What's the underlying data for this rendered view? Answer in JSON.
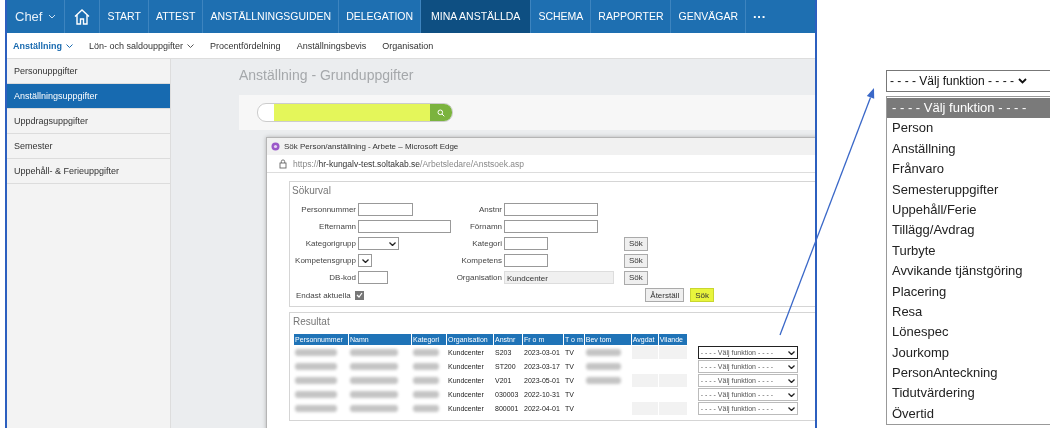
{
  "top_nav": {
    "role": {
      "label": "Chef"
    },
    "items": [
      {
        "label": "START",
        "selected": false
      },
      {
        "label": "ATTEST",
        "selected": false
      },
      {
        "label": "ANSTÄLLNINGSGUIDEN",
        "selected": false
      },
      {
        "label": "DELEGATION",
        "selected": false
      },
      {
        "label": "MINA ANSTÄLLDA",
        "selected": true
      },
      {
        "label": "SCHEMA",
        "selected": false
      },
      {
        "label": "RAPPORTER",
        "selected": false
      },
      {
        "label": "GENVÄGAR",
        "selected": false
      }
    ],
    "more": "···"
  },
  "sub_nav": [
    {
      "label": "Anställning",
      "selected": true,
      "has_menu": true
    },
    {
      "label": "Lön- och saldouppgifter",
      "selected": false,
      "has_menu": true
    },
    {
      "label": "Procentfördelning",
      "selected": false,
      "has_menu": false
    },
    {
      "label": "Anställningsbevis",
      "selected": false,
      "has_menu": false
    },
    {
      "label": "Organisation",
      "selected": false,
      "has_menu": false
    }
  ],
  "sidebar": {
    "items": [
      {
        "label": "Personuppgifter",
        "selected": false
      },
      {
        "label": "Anställningsuppgifter",
        "selected": true
      },
      {
        "label": "Uppdragsuppgifter",
        "selected": false
      },
      {
        "label": "Semester",
        "selected": false
      },
      {
        "label": "Uppehåll- & Ferieuppgifter",
        "selected": false
      }
    ]
  },
  "main": {
    "title": "Anställning - Grunduppgifter",
    "search": {
      "highlighted": true
    }
  },
  "popup": {
    "title": "Sök Person/anställning - Arbete – Microsoft Edge",
    "url": "https://**hr-kungalv-test.soltakab.se**/Arbetsledare/Anstsoek.asp",
    "criteria": {
      "legend": "Sökurval",
      "rows": [
        {
          "left": {
            "label": "Personnummer",
            "kind": "text"
          },
          "right": {
            "label": "Anstnr",
            "kind": "text"
          }
        },
        {
          "left": {
            "label": "Efternamn",
            "kind": "text"
          },
          "right": {
            "label": "Förnamn",
            "kind": "text"
          }
        },
        {
          "left": {
            "label": "Kategorigrupp",
            "kind": "select"
          },
          "right": {
            "label": "Kategori",
            "kind": "text"
          },
          "button": "Sök"
        },
        {
          "left": {
            "label": "Kompetensgrupp",
            "kind": "select"
          },
          "right": {
            "label": "Kompetens",
            "kind": "text"
          },
          "button": "Sök"
        },
        {
          "left": {
            "label": "DB-kod",
            "kind": "text"
          },
          "right": {
            "label": "Organisation",
            "kind": "readonly",
            "value": "Kundcenter"
          },
          "button": "Sök"
        }
      ],
      "checkbox": {
        "label": "Endast aktuella",
        "checked": true
      },
      "buttons": [
        {
          "label": "Återställ",
          "highlighted": false
        },
        {
          "label": "Sök",
          "highlighted": true
        }
      ]
    },
    "results": {
      "legend": "Resultat",
      "columns": [
        "Personnummer",
        "Namn",
        "Kategori",
        "Organisation",
        "Anstnr",
        "Fr o m",
        "T o m",
        "Bev tom",
        "Avgdat",
        "Vilande"
      ],
      "rows": [
        {
          "organisation": "Kundcenter",
          "anstnr": "S203",
          "from": "2023-03-01",
          "tom": "TV",
          "bev_tom_blurred": true,
          "action": "- - - - Välj funktion - - - -",
          "focused": true
        },
        {
          "organisation": "Kundcenter",
          "anstnr": "ST200",
          "from": "2023-03-17",
          "tom": "TV",
          "bev_tom_blurred": true,
          "action": "- - - - Välj funktion - - - -",
          "focused": false
        },
        {
          "organisation": "Kundcenter",
          "anstnr": "V201",
          "from": "2023-05-01",
          "tom": "TV",
          "bev_tom_blurred": true,
          "action": "- - - - Välj funktion - - - -",
          "focused": false
        },
        {
          "organisation": "Kundcenter",
          "anstnr": "030003",
          "from": "2022-10-31",
          "tom": "TV",
          "bev_tom_blurred": false,
          "action": "- - - - Välj funktion - - - -",
          "focused": false
        },
        {
          "organisation": "Kundcenter",
          "anstnr": "800001",
          "from": "2022-04-01",
          "tom": "TV",
          "bev_tom_blurred": false,
          "action": "- - - - Välj funktion - - - -",
          "focused": false
        }
      ]
    }
  },
  "function_dropdown": {
    "value": "- - - - Välj funktion - - - -",
    "options": [
      {
        "label": "- - - - Välj funktion - - - -",
        "selected": true
      },
      {
        "label": "Person",
        "selected": false
      },
      {
        "label": "Anställning",
        "selected": false
      },
      {
        "label": "Frånvaro",
        "selected": false
      },
      {
        "label": "Semesteruppgifter",
        "selected": false
      },
      {
        "label": "Uppehåll/Ferie",
        "selected": false
      },
      {
        "label": "Tillägg/Avdrag",
        "selected": false
      },
      {
        "label": "Turbyte",
        "selected": false
      },
      {
        "label": "Avvikande tjänstgöring",
        "selected": false
      },
      {
        "label": "Placering",
        "selected": false
      },
      {
        "label": "Resa",
        "selected": false
      },
      {
        "label": "Lönespec",
        "selected": false
      },
      {
        "label": "Jourkomp",
        "selected": false
      },
      {
        "label": "PersonAnteckning",
        "selected": false
      },
      {
        "label": "Tidutvärdering",
        "selected": false
      },
      {
        "label": "Övertid",
        "selected": false
      }
    ]
  }
}
